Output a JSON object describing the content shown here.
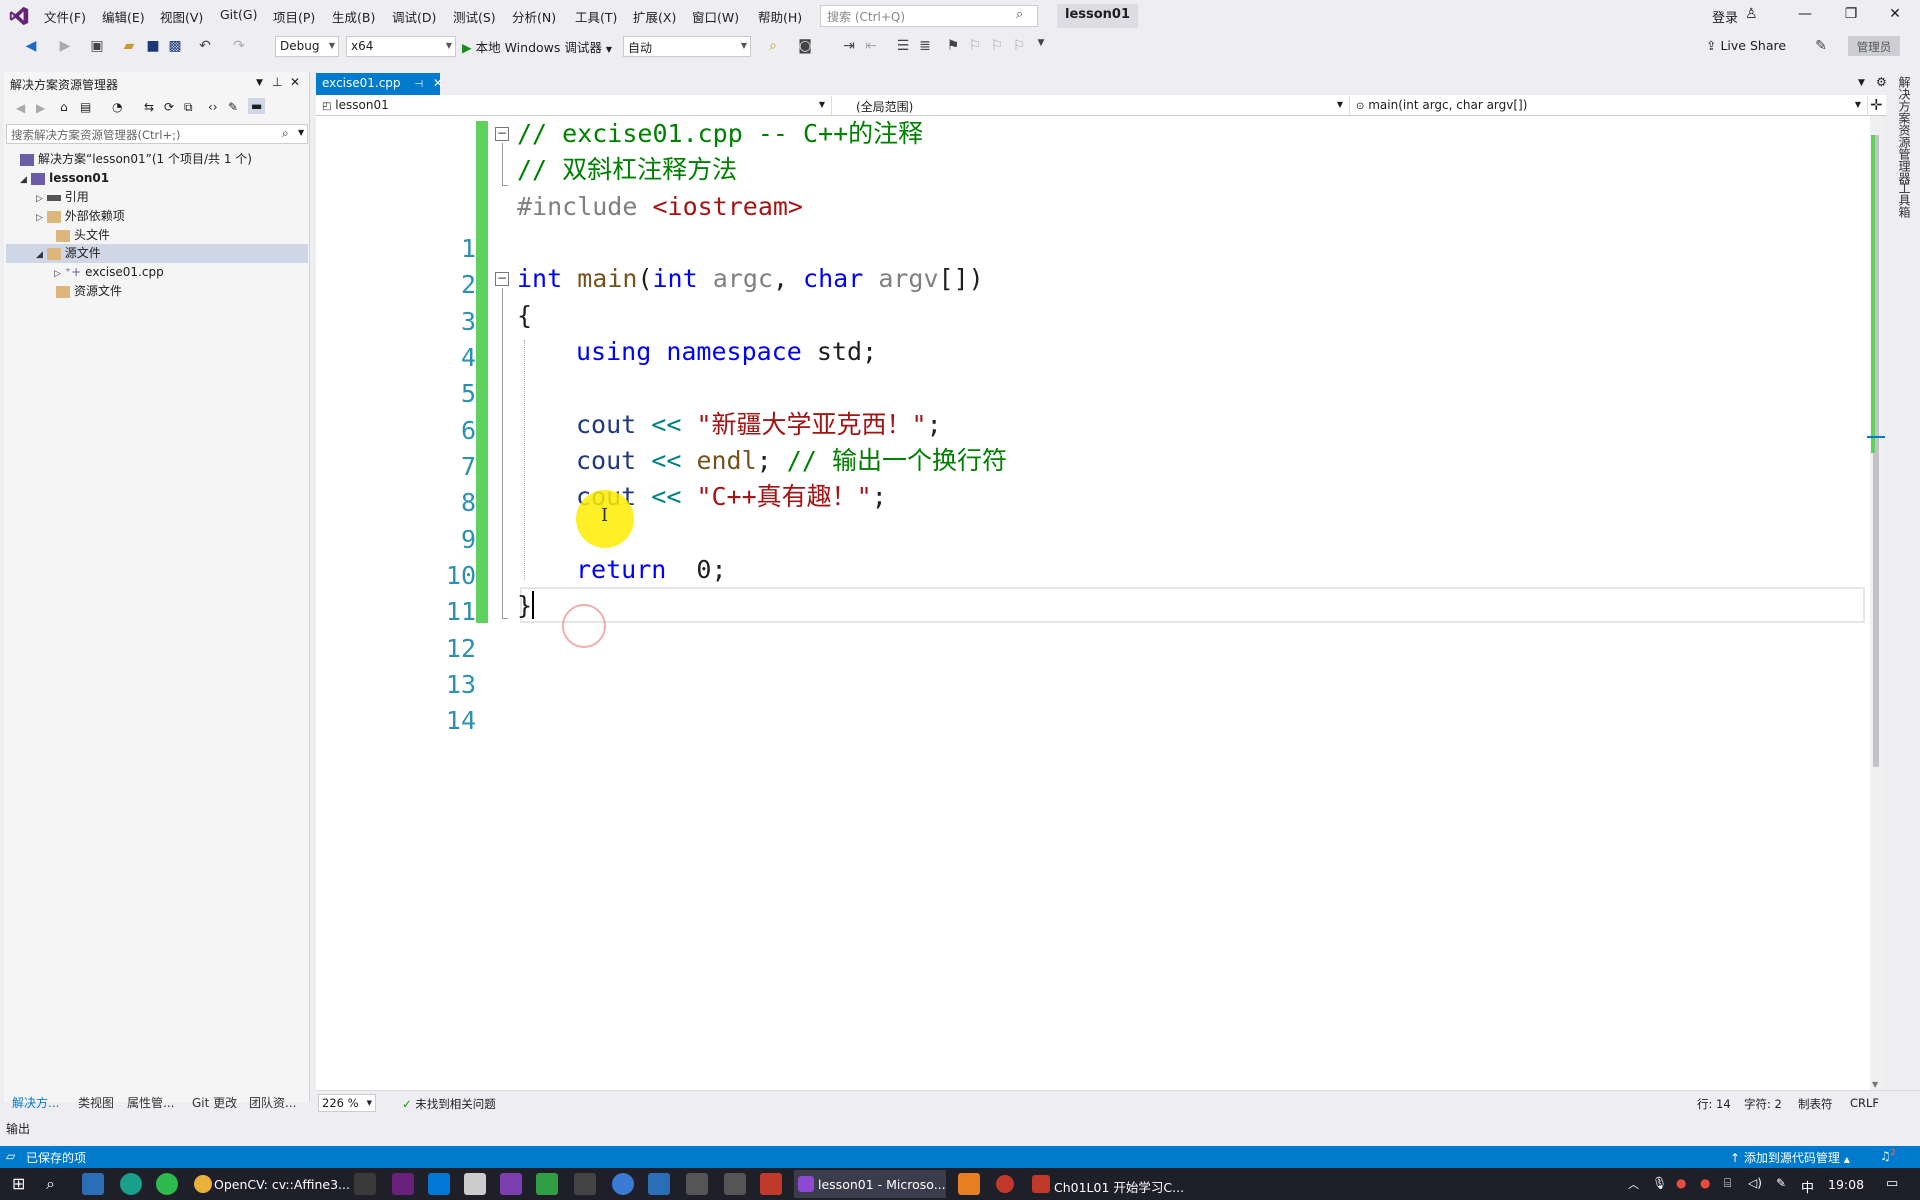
{
  "window": {
    "menus": [
      "文件(F)",
      "编辑(E)",
      "视图(V)",
      "Git(G)",
      "项目(P)",
      "生成(B)",
      "调试(D)",
      "测试(S)",
      "分析(N)",
      "工具(T)",
      "扩展(X)",
      "窗口(W)",
      "帮助(H)"
    ],
    "search_placeholder": "搜索 (Ctrl+Q)",
    "solution_badge": "lesson01",
    "login": "登录",
    "minimize": "—",
    "restore": "❐",
    "close": "✕"
  },
  "toolbar": {
    "config": "Debug",
    "platform": "x64",
    "run_label": "本地 Windows 调试器",
    "run_mode": "自动",
    "live_share": "Live Share",
    "admin": "管理员"
  },
  "solution_explorer": {
    "title": "解决方案资源管理器",
    "search_placeholder": "搜索解决方案资源管理器(Ctrl+;)",
    "solution": "解决方案“lesson01”(1 个项目/共 1 个)",
    "project": "lesson01",
    "items": [
      "引用",
      "外部依赖项",
      "头文件",
      "源文件",
      "excise01.cpp",
      "资源文件"
    ],
    "bottom_tabs": [
      "解决方...",
      "类视图",
      "属性管...",
      "Git 更改",
      "团队资..."
    ]
  },
  "editor": {
    "tab_name": "excise01.cpp",
    "nav_project": "lesson01",
    "nav_scope": "(全局范围)",
    "nav_member": "main(int argc, char argv[])",
    "line_numbers": [
      "1",
      "2",
      "3",
      "4",
      "5",
      "6",
      "7",
      "8",
      "9",
      "10",
      "11",
      "12",
      "13",
      "14"
    ],
    "lines": {
      "l1": "// excise01.cpp -- C++的注释",
      "l2": "// 双斜杠注释方法",
      "l3_pp": "#include ",
      "l3_hdr": "<iostream>",
      "l5_int": "int",
      "l5_main": "main",
      "l5_open": "(",
      "l5_int2": "int",
      "l5_argc": "argc",
      "l5_comma": ", ",
      "l5_char": "char",
      "l5_argv": "argv",
      "l5_close": "[])",
      "l6": "{",
      "l7_using": "using",
      "l7_namespace": "namespace",
      "l7_std": "std;",
      "l9_cout": "cout",
      "l9_op": "<<",
      "l9_str": "\"新疆大学亚克西！\"",
      "l9_semi": ";",
      "l10_cout": "cout",
      "l10_op": "<<",
      "l10_endl": "endl",
      "l10_semi": ";",
      "l10_cm": "// 输出一个换行符",
      "l11_cout": "cout",
      "l11_op": "<<",
      "l11_str": "\"C++真有趣！\"",
      "l11_semi": ";",
      "l13_return": "return",
      "l13_val": "0;",
      "l14": "}"
    },
    "zoom": "226 %",
    "issues": "未找到相关问题",
    "row": "行: 14",
    "col": "字符: 2",
    "tabs_mode": "制表符",
    "eol": "CRLF"
  },
  "right_dock": [
    "解决方案资源管理器",
    "工具箱"
  ],
  "output_label": "输出",
  "status": {
    "text": "已保存的项",
    "source_control": "添加到源代码管理",
    "notification_count": "2"
  },
  "taskbar": {
    "items": [
      "OpenCV: cv::Affine3...",
      "lesson01 - Microso...",
      "Ch01L01 开始学习C..."
    ],
    "ime": "中",
    "clock": "19:08"
  },
  "colors": {
    "accent": "#007acc",
    "change_bar": "#5ed15e",
    "comment": "#008000",
    "keyword": "#0000ff",
    "string": "#a31515",
    "line_number": "#2b91af"
  }
}
